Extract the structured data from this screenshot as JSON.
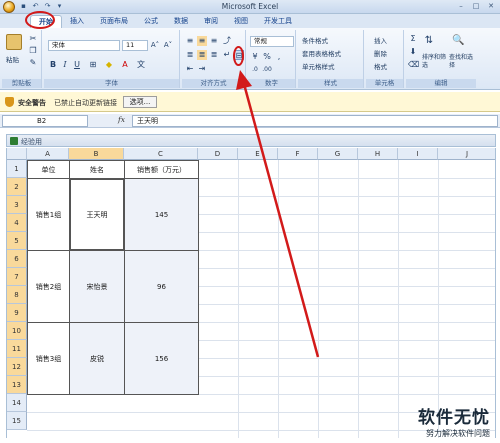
{
  "window": {
    "title": "Microsoft Excel"
  },
  "tabs": [
    "开始",
    "插入",
    "页面布局",
    "公式",
    "数据",
    "审阅",
    "视图",
    "开发工具"
  ],
  "ribbon": {
    "clipboard": {
      "paste_label": "粘贴",
      "group_label": "剪贴板"
    },
    "font": {
      "font_name": "宋体",
      "font_size": "11",
      "group_label": "字体"
    },
    "alignment": {
      "group_label": "对齐方式"
    },
    "number": {
      "format": "常规",
      "group_label": "数字"
    },
    "styles": {
      "items": [
        "条件格式",
        "套用表格格式",
        "单元格样式"
      ],
      "group_label": "样式"
    },
    "cells": {
      "items": [
        "插入",
        "删除",
        "格式"
      ],
      "group_label": "单元格"
    },
    "editing": {
      "sort_label": "排序和筛选",
      "find_label": "查找和选择",
      "group_label": "编辑"
    }
  },
  "security_bar": {
    "title": "安全警告",
    "message": "已禁止自动更新链接",
    "options_label": "选项..."
  },
  "formula_bar": {
    "name_box": "B2",
    "fx": "fx",
    "formula": "王天明"
  },
  "workbook": {
    "name": "经验用"
  },
  "sheet": {
    "columns": [
      "A",
      "B",
      "C",
      "D",
      "E",
      "F",
      "G",
      "H",
      "I",
      "J"
    ],
    "rows": [
      "1",
      "2",
      "3",
      "4",
      "5",
      "6",
      "7",
      "8",
      "9",
      "10",
      "11",
      "12",
      "13",
      "14",
      "15"
    ],
    "headers": [
      "单位",
      "姓名",
      "销售额（万元）"
    ],
    "records": [
      {
        "unit": "销售1组",
        "name": "王天明",
        "sales": "145"
      },
      {
        "unit": "销售2组",
        "name": "宋怡景",
        "sales": "96"
      },
      {
        "unit": "销售3组",
        "name": "皮锐",
        "sales": "156"
      }
    ]
  },
  "watermark": {
    "brand": "软件无忧",
    "tagline": "努力解决软件问题"
  },
  "colors": {
    "annotation": "#d21a1a",
    "ribbon": "#dce7f5",
    "selected_header": "#f9d99b"
  }
}
